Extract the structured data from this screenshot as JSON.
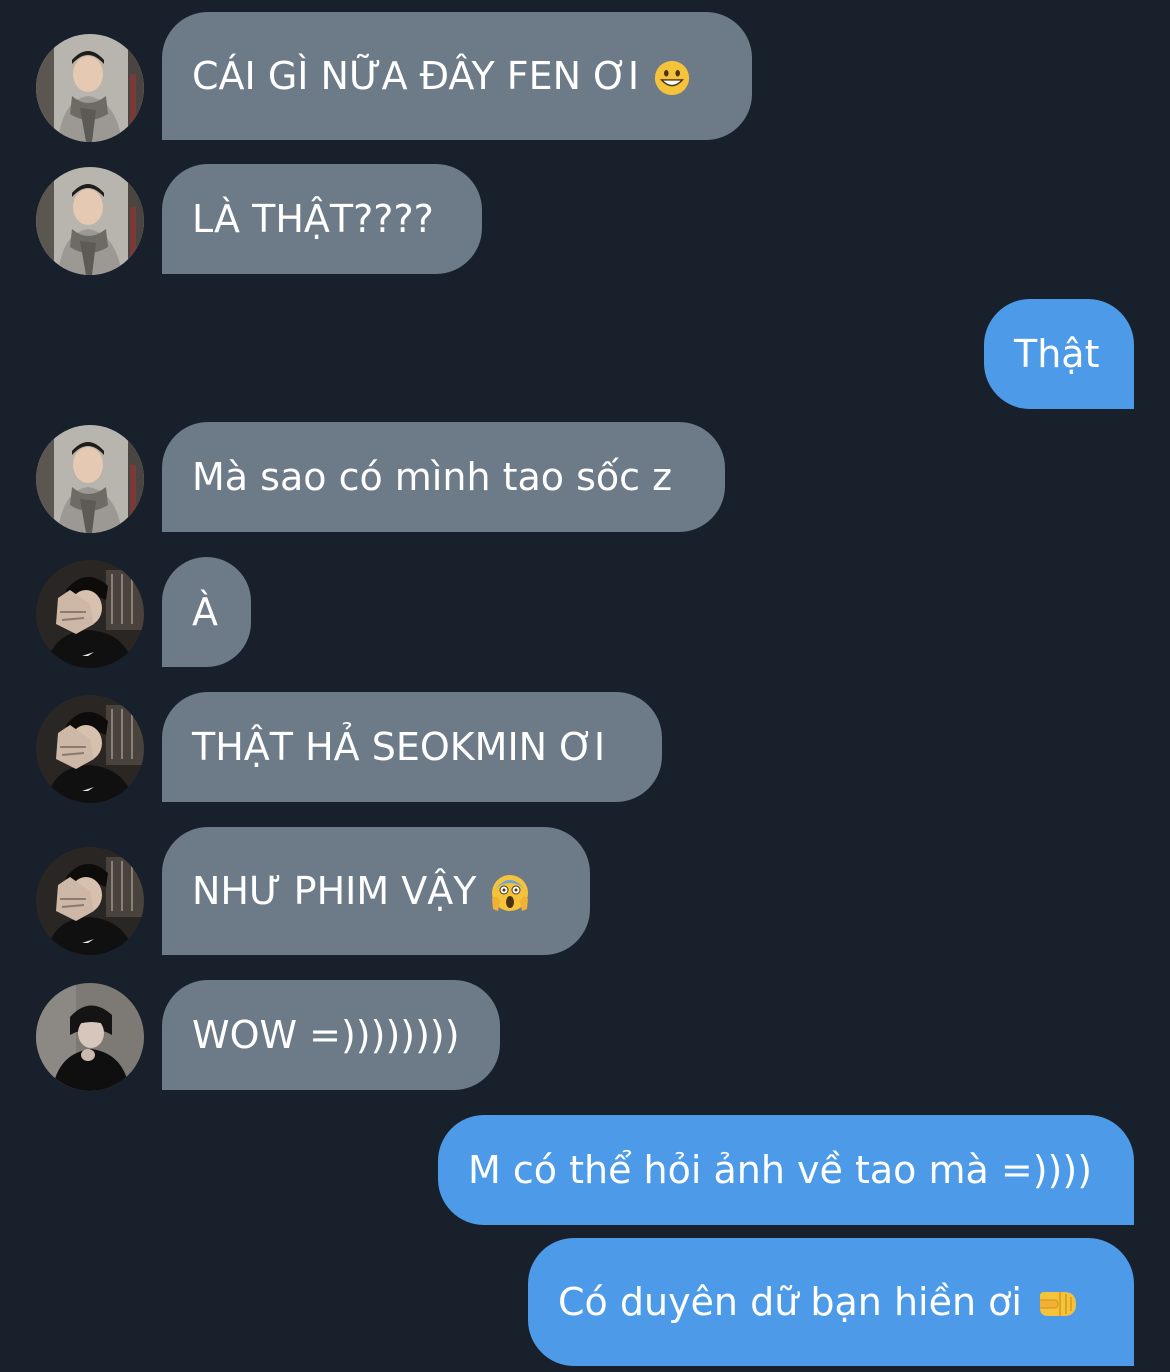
{
  "messages": [
    {
      "side": "incoming",
      "avatar": "user-a-avatar",
      "text": "CÁI GÌ NỮA ĐÂY FEN ƠI",
      "emoji": "grinning-face-emoji"
    },
    {
      "side": "incoming",
      "avatar": "user-a-avatar",
      "text": "LÀ THẬT????"
    },
    {
      "side": "outgoing",
      "text": "Thật"
    },
    {
      "side": "incoming",
      "avatar": "user-a-avatar",
      "text": "Mà sao có mình tao sốc z"
    },
    {
      "side": "incoming",
      "avatar": "user-b-avatar",
      "text": "À"
    },
    {
      "side": "incoming",
      "avatar": "user-b-avatar",
      "text": "THẬT HẢ SEOKMIN ƠI"
    },
    {
      "side": "incoming",
      "avatar": "user-b-avatar",
      "text": "NHƯ PHIM VẬY",
      "emoji": "screaming-face-emoji"
    },
    {
      "side": "incoming",
      "avatar": "user-c-avatar",
      "text": "WOW =))))))))"
    },
    {
      "side": "outgoing",
      "text": "M có thể hỏi ảnh về tao mà =))))"
    },
    {
      "side": "outgoing",
      "text": "Có duyên dữ bạn hiền ơi",
      "emoji": "right-facing-fist-emoji"
    }
  ],
  "colors": {
    "background": "#17202b",
    "incoming_bubble": "#6d7a88",
    "outgoing_bubble": "#4d9be8",
    "text": "#ffffff"
  }
}
